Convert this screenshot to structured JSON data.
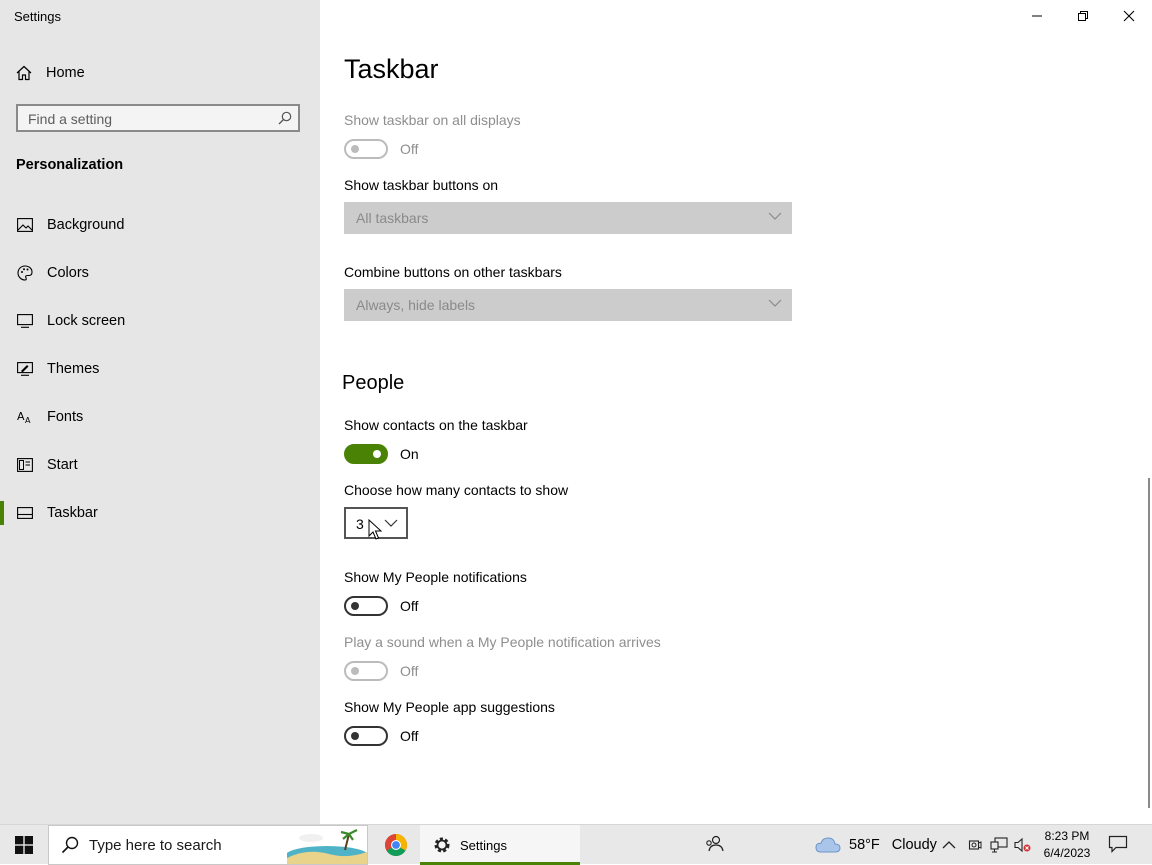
{
  "window": {
    "title": "Settings"
  },
  "sidebar": {
    "home_label": "Home",
    "search_placeholder": "Find a setting",
    "section": "Personalization",
    "items": [
      {
        "label": "Background",
        "icon": "picture-icon"
      },
      {
        "label": "Colors",
        "icon": "palette-icon"
      },
      {
        "label": "Lock screen",
        "icon": "monitor-icon"
      },
      {
        "label": "Themes",
        "icon": "brush-icon"
      },
      {
        "label": "Fonts",
        "icon": "fonts-icon"
      },
      {
        "label": "Start",
        "icon": "start-icon"
      },
      {
        "label": "Taskbar",
        "icon": "taskbar-icon",
        "active": true
      }
    ]
  },
  "main": {
    "title": "Taskbar",
    "show_all_displays": {
      "label": "Show taskbar on all displays",
      "state": "Off"
    },
    "buttons_on": {
      "label": "Show taskbar buttons on",
      "value": "All taskbars"
    },
    "combine_other": {
      "label": "Combine buttons on other taskbars",
      "value": "Always, hide labels"
    },
    "people": {
      "heading": "People",
      "show_contacts": {
        "label": "Show contacts on the taskbar",
        "state": "On"
      },
      "contacts_count": {
        "label": "Choose how many contacts to show",
        "value": "3"
      },
      "notifications": {
        "label": "Show My People notifications",
        "state": "Off"
      },
      "sound": {
        "label": "Play a sound when a My People notification arrives",
        "state": "Off"
      },
      "suggestions": {
        "label": "Show My People app suggestions",
        "state": "Off"
      }
    }
  },
  "taskbar": {
    "search_placeholder": "Type here to search",
    "settings_label": "Settings",
    "weather_temp": "58°F",
    "weather_cond": "Cloudy",
    "time": "8:23 PM",
    "date": "6/4/2023"
  },
  "colors": {
    "accent": "#498205"
  }
}
